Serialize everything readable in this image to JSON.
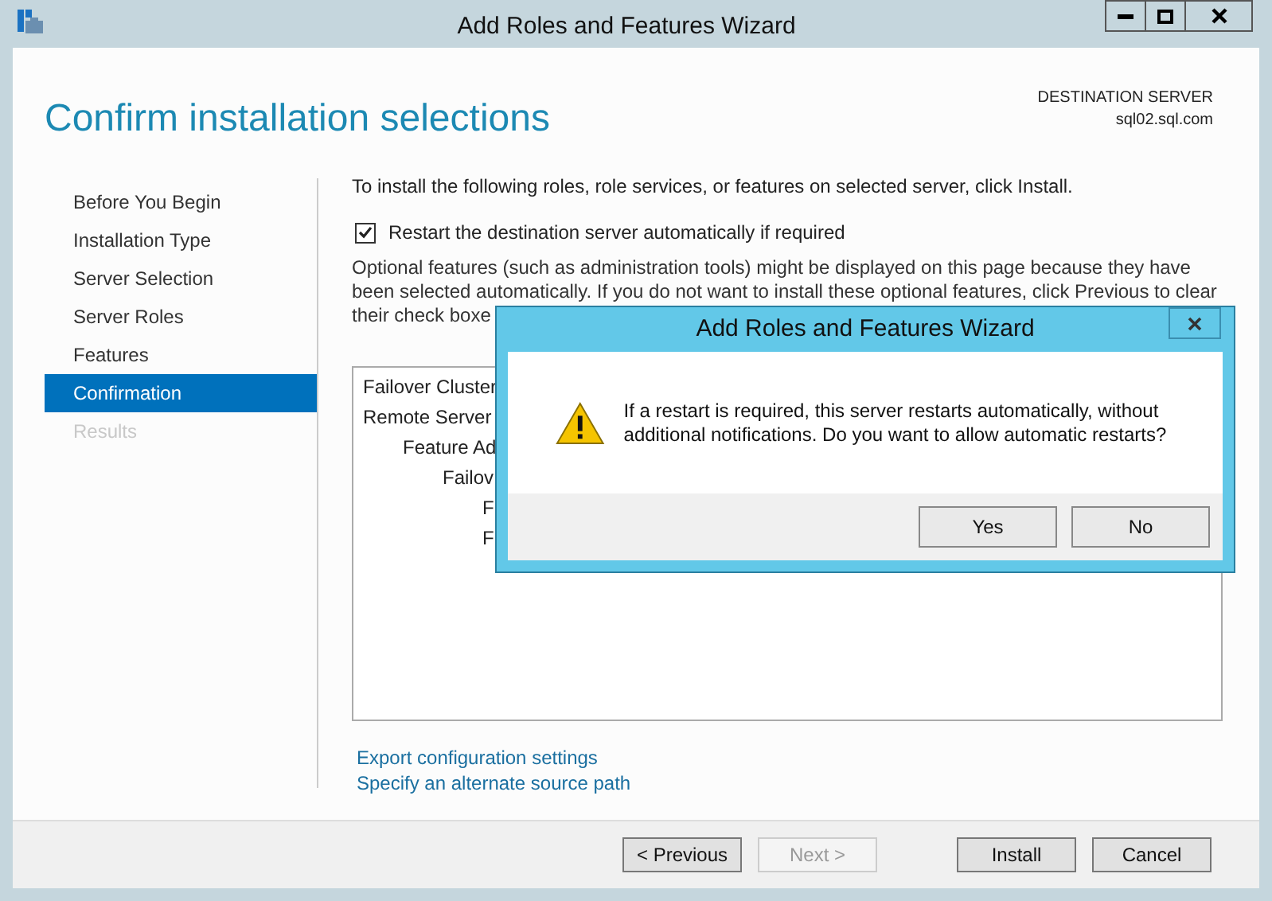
{
  "window": {
    "title": "Add Roles and Features Wizard"
  },
  "header": {
    "title": "Confirm installation selections",
    "server_label": "DESTINATION SERVER",
    "server_name": "sql02.sql.com"
  },
  "sidebar": {
    "items": [
      {
        "label": "Before You Begin",
        "selected": false,
        "disabled": false
      },
      {
        "label": "Installation Type",
        "selected": false,
        "disabled": false
      },
      {
        "label": "Server Selection",
        "selected": false,
        "disabled": false
      },
      {
        "label": "Server Roles",
        "selected": false,
        "disabled": false
      },
      {
        "label": "Features",
        "selected": false,
        "disabled": false
      },
      {
        "label": "Confirmation",
        "selected": true,
        "disabled": false
      },
      {
        "label": "Results",
        "selected": false,
        "disabled": true
      }
    ]
  },
  "content": {
    "intro": "To install the following roles, role services, or features on selected server, click Install.",
    "restart_checkbox": {
      "label": "Restart the destination server automatically if required",
      "checked": true
    },
    "note": [
      "Optional features (such as administration tools) might be displayed on this page because they have",
      "been selected automatically. If you do not want to install these optional features, click Previous to clear",
      "their check boxe"
    ],
    "tree": [
      {
        "label": "Failover Cluster"
      },
      {
        "label": "Remote Server",
        "children": [
          {
            "label": "Feature Ad",
            "children": [
              {
                "label": "Failov",
                "children": [
                  {
                    "label": "F"
                  },
                  {
                    "label": "F"
                  }
                ]
              }
            ]
          }
        ]
      }
    ],
    "links": [
      "Export configuration settings",
      "Specify an alternate source path"
    ]
  },
  "footer": {
    "buttons": [
      {
        "label": "< Previous",
        "disabled": false
      },
      {
        "label": "Next >",
        "disabled": true
      },
      {
        "label": "Install",
        "disabled": false
      },
      {
        "label": "Cancel",
        "disabled": false
      }
    ]
  },
  "dialog": {
    "title": "Add Roles and Features Wizard",
    "message": "If a restart is required, this server restarts automatically, without additional notifications. Do you want to allow automatic restarts?",
    "buttons": [
      "Yes",
      "No"
    ]
  }
}
